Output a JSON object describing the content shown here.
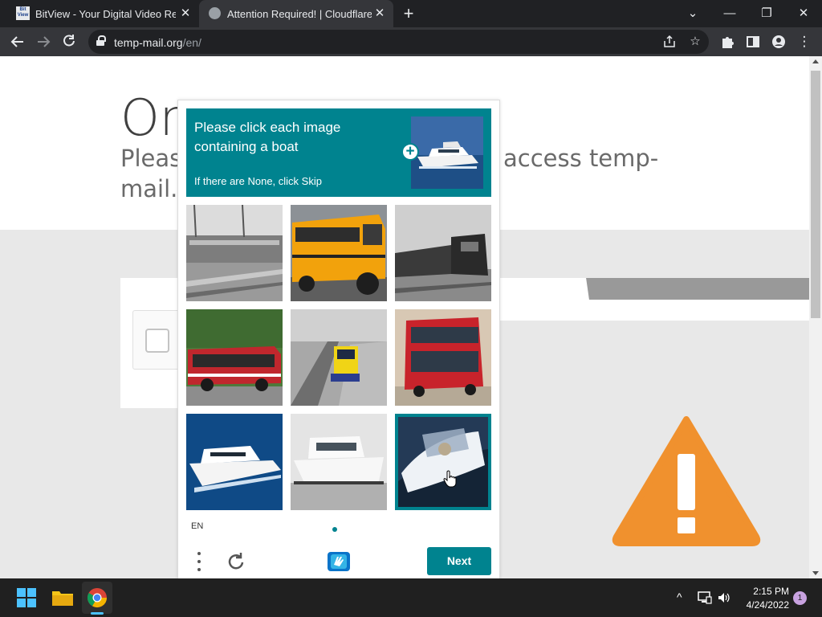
{
  "browser": {
    "tabs": [
      {
        "favicon_text": "BitView",
        "title": "BitView - Your Digital Video Repository",
        "active": false
      },
      {
        "title": "Attention Required! | Cloudflare",
        "active": true
      }
    ],
    "new_tab_label": "+",
    "window_controls": {
      "tab_search": "⌄",
      "minimize": "—",
      "restore": "❐",
      "close": "✕"
    },
    "url": {
      "host": "temp-mail.org",
      "path": "/en/"
    }
  },
  "page": {
    "heading": "On",
    "subtitle_left": "Please",
    "subtitle_right": "access temp-",
    "subtitle_line2": "mail.c"
  },
  "challenge": {
    "prompt": "Please click each image containing a boat",
    "subprompt": "If there are None, click Skip",
    "example_icon": "plus-icon",
    "tiles": [
      {
        "content": "train station",
        "selected": false
      },
      {
        "content": "school bus",
        "selected": false
      },
      {
        "content": "freight train",
        "selected": false
      },
      {
        "content": "red bus",
        "selected": false
      },
      {
        "content": "train at platform",
        "selected": false
      },
      {
        "content": "double decker bus",
        "selected": false
      },
      {
        "content": "yacht",
        "selected": false
      },
      {
        "content": "motor boat",
        "selected": false
      },
      {
        "content": "boat",
        "selected": true
      }
    ],
    "language": "EN",
    "next_label": "Next",
    "accent_color": "#00838f"
  },
  "taskbar": {
    "time": "2:15 PM",
    "date": "4/24/2022",
    "notifications": "1",
    "tray_chevron": "^"
  },
  "colors": {
    "warning": "#f0912e",
    "tabstrip": "#202124",
    "toolbar": "#35363a"
  }
}
